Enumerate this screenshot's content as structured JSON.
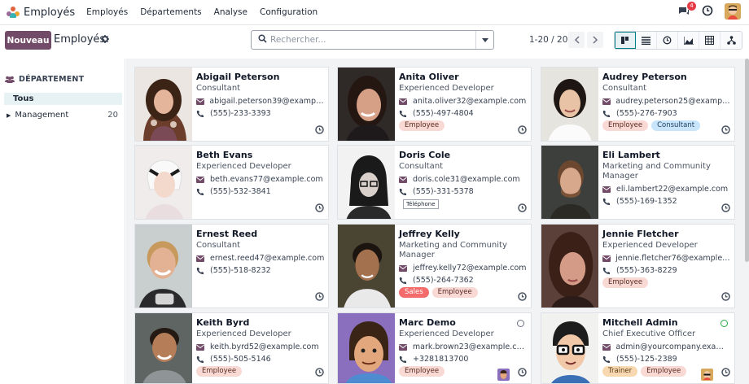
{
  "app": {
    "name": "Employés"
  },
  "menu": [
    "Employés",
    "Départements",
    "Analyse",
    "Configuration"
  ],
  "notifications": {
    "count": "4"
  },
  "control": {
    "new_label": "Nouveau",
    "title": "Employés",
    "search_placeholder": "Rechercher...",
    "pager": "1-20 / 20"
  },
  "sidebar": {
    "heading": "DÉPARTEMENT",
    "all_label": "Tous",
    "items": [
      {
        "label": "Management",
        "count": "20"
      }
    ]
  },
  "tooltip": "Téléphone",
  "employees": [
    {
      "name": "Abigail Peterson",
      "job": "Consultant",
      "email": "abigail.peterson39@example....",
      "phone": "(555)-233-3393",
      "tags": []
    },
    {
      "name": "Anita Oliver",
      "job": "Experienced Developer",
      "email": "anita.oliver32@example.com",
      "phone": "(555)-497-4804",
      "tags": [
        "Employee"
      ]
    },
    {
      "name": "Audrey Peterson",
      "job": "Consultant",
      "email": "audrey.peterson25@example....",
      "phone": "(555)-276-7903",
      "tags": [
        "Employee",
        "Consultant"
      ]
    },
    {
      "name": "Beth Evans",
      "job": "Experienced Developer",
      "email": "beth.evans77@example.com",
      "phone": "(555)-532-3841",
      "tags": []
    },
    {
      "name": "Doris Cole",
      "job": "Consultant",
      "email": "doris.cole31@example.com",
      "phone": "(555)-331-5378",
      "tags": []
    },
    {
      "name": "Eli Lambert",
      "job": "Marketing and Community Manager",
      "email": "eli.lambert22@example.com",
      "phone": "(555)-169-1352",
      "tags": []
    },
    {
      "name": "Ernest Reed",
      "job": "Consultant",
      "email": "ernest.reed47@example.com",
      "phone": "(555)-518-8232",
      "tags": []
    },
    {
      "name": "Jeffrey Kelly",
      "job": "Marketing and Community Manager",
      "email": "jeffrey.kelly72@example.com",
      "phone": "(555)-264-7362",
      "tags": [
        "Sales",
        "Employee"
      ]
    },
    {
      "name": "Jennie Fletcher",
      "job": "Experienced Developer",
      "email": "jennie.fletcher76@example.com",
      "phone": "(555)-363-8229",
      "tags": [
        "Employee"
      ]
    },
    {
      "name": "Keith Byrd",
      "job": "Experienced Developer",
      "email": "keith.byrd52@example.com",
      "phone": "(555)-505-5146",
      "tags": [
        "Employee"
      ]
    },
    {
      "name": "Marc Demo",
      "job": "Experienced Developer",
      "email": "mark.brown23@example.com",
      "phone": "+3281813700",
      "tags": [
        "Employee"
      ]
    },
    {
      "name": "Mitchell Admin",
      "job": "Chief Executive Officer",
      "email": "admin@yourcompany.exampl...",
      "phone": "(555)-125-2389",
      "tags": [
        "Trainer",
        "Employee"
      ]
    }
  ],
  "colors": {
    "brand": "#714b67",
    "accent": "#017e84",
    "employee_tag": "#f9d9d4",
    "consultant_tag": "#c9e5fb",
    "sales_tag": "#f36b6b",
    "trainer_tag": "#f7d8b0"
  }
}
